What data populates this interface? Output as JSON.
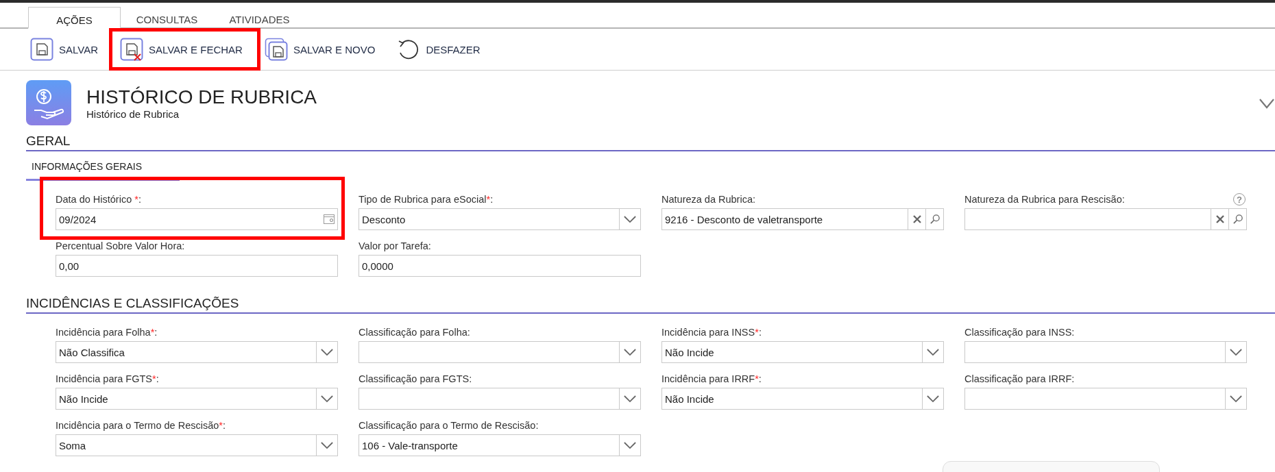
{
  "tabs": [
    {
      "label": "AÇÕES",
      "selected": true
    },
    {
      "label": "CONSULTAS",
      "selected": false
    },
    {
      "label": "ATIVIDADES",
      "selected": false
    }
  ],
  "toolbar": [
    {
      "label": "SALVAR",
      "kind": "save",
      "highlighted": false
    },
    {
      "label": "SALVAR E FECHAR",
      "kind": "saveclose",
      "highlighted": true
    },
    {
      "label": "SALVAR E NOVO",
      "kind": "savenew",
      "highlighted": false
    },
    {
      "label": "DESFAZER",
      "kind": "undo",
      "highlighted": false
    }
  ],
  "header": {
    "title": "HISTÓRICO DE RUBRICA",
    "subtitle": "Histórico de Rubrica"
  },
  "sections": [
    {
      "title": "GERAL",
      "subtabs": [
        {
          "label": "INFORMAÇÕES GERAIS",
          "selected": true
        }
      ],
      "fields": [
        {
          "label": "Data do Histórico ",
          "mark": "*",
          "end": ":",
          "kind": "date",
          "value": "09/2024",
          "highlighted": true
        },
        {
          "label": "Tipo de Rubrica para eSocial",
          "mark": "*",
          "end": ":",
          "kind": "select",
          "value": "Desconto",
          "highlighted": false
        },
        {
          "label": "Natureza da Rubrica:",
          "kind": "lookup",
          "value": "9216 - Desconto de valetransporte",
          "highlighted": false
        },
        {
          "label": "Natureza da Rubrica para Rescisão:",
          "kind": "lookup",
          "help": "?",
          "highlighted": false
        },
        {
          "label": "Percentual Sobre Valor Hora:",
          "kind": "text",
          "value": "0,00",
          "highlighted": false
        },
        {
          "label": "Valor por Tarefa:",
          "kind": "text",
          "value": "0,0000",
          "highlighted": false
        }
      ]
    },
    {
      "title": "INCIDÊNCIAS E CLASSIFICAÇÕES",
      "fields": [
        {
          "label": "Incidência para Folha",
          "mark": "*",
          "end": ":",
          "kind": "select",
          "value": "Não Classifica",
          "highlighted": false
        },
        {
          "label": "Classificação para Folha:",
          "kind": "select",
          "highlighted": false
        },
        {
          "label": "Incidência para INSS",
          "mark": "*",
          "end": ":",
          "kind": "select",
          "value": "Não Incide",
          "highlighted": false
        },
        {
          "label": "Classificação para INSS:",
          "kind": "select",
          "highlighted": false
        },
        {
          "label": "Incidência para FGTS",
          "mark": "*",
          "end": ":",
          "kind": "select",
          "value": "Não Incide",
          "highlighted": false
        },
        {
          "label": "Classificação para FGTS:",
          "kind": "select",
          "highlighted": false
        },
        {
          "label": "Incidência para IRRF",
          "mark": "*",
          "end": ":",
          "kind": "select",
          "value": "Não Incide",
          "highlighted": false
        },
        {
          "label": "Classificação para IRRF:",
          "kind": "select",
          "highlighted": false
        },
        {
          "label": "Incidência para o Termo de Rescisão",
          "mark": "*",
          "end": ":",
          "kind": "select",
          "value": "Soma",
          "highlighted": false
        },
        {
          "label": "Classificação para o Termo de Rescisão:",
          "kind": "select",
          "value": "106 - Vale-transporte",
          "highlighted": false
        }
      ]
    }
  ]
}
